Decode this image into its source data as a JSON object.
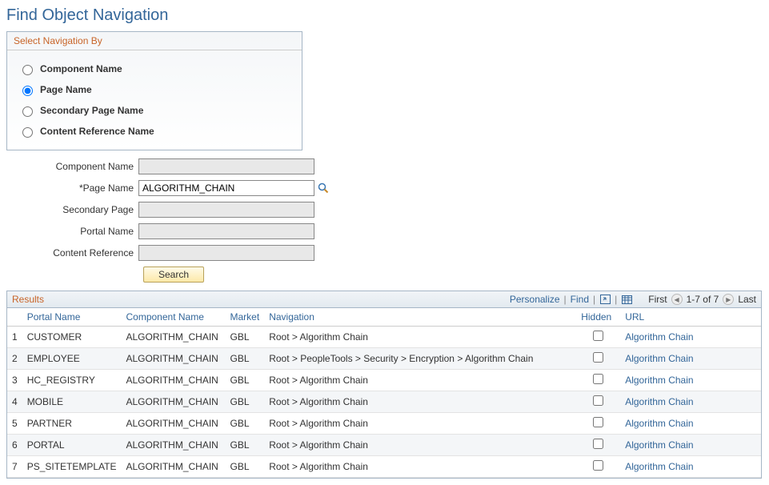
{
  "page": {
    "title": "Find Object Navigation"
  },
  "navBy": {
    "legend": "Select Navigation By",
    "options": [
      {
        "key": "component",
        "label": "Component Name",
        "checked": false
      },
      {
        "key": "page",
        "label": "Page Name",
        "checked": true
      },
      {
        "key": "secondary",
        "label": "Secondary Page Name",
        "checked": false
      },
      {
        "key": "cref",
        "label": "Content Reference Name",
        "checked": false
      }
    ]
  },
  "form": {
    "componentName": {
      "label": "Component Name",
      "value": "",
      "enabled": false
    },
    "pageName": {
      "label": "*Page Name",
      "value": "ALGORITHM_CHAIN",
      "enabled": true,
      "lookup": true
    },
    "secondaryPage": {
      "label": "Secondary Page",
      "value": "",
      "enabled": false
    },
    "portalName": {
      "label": "Portal Name",
      "value": "",
      "enabled": false
    },
    "contentReference": {
      "label": "Content Reference",
      "value": "",
      "enabled": false
    },
    "searchLabel": "Search"
  },
  "results": {
    "title": "Results",
    "toolbar": {
      "personalize": "Personalize",
      "find": "Find",
      "first": "First",
      "range": "1-7 of 7",
      "last": "Last"
    },
    "columns": {
      "idx": "",
      "portal": "Portal Name",
      "component": "Component Name",
      "market": "Market",
      "navigation": "Navigation",
      "hidden": "Hidden",
      "url": "URL"
    },
    "rows": [
      {
        "idx": "1",
        "portal": "CUSTOMER",
        "component": "ALGORITHM_CHAIN",
        "market": "GBL",
        "navigation": "Root > Algorithm Chain",
        "hidden": false,
        "url": "Algorithm Chain"
      },
      {
        "idx": "2",
        "portal": "EMPLOYEE",
        "component": "ALGORITHM_CHAIN",
        "market": "GBL",
        "navigation": "Root > PeopleTools > Security > Encryption > Algorithm Chain",
        "hidden": false,
        "url": "Algorithm Chain"
      },
      {
        "idx": "3",
        "portal": "HC_REGISTRY",
        "component": "ALGORITHM_CHAIN",
        "market": "GBL",
        "navigation": "Root > Algorithm Chain",
        "hidden": false,
        "url": "Algorithm Chain"
      },
      {
        "idx": "4",
        "portal": "MOBILE",
        "component": "ALGORITHM_CHAIN",
        "market": "GBL",
        "navigation": "Root > Algorithm Chain",
        "hidden": false,
        "url": "Algorithm Chain"
      },
      {
        "idx": "5",
        "portal": "PARTNER",
        "component": "ALGORITHM_CHAIN",
        "market": "GBL",
        "navigation": "Root > Algorithm Chain",
        "hidden": false,
        "url": "Algorithm Chain"
      },
      {
        "idx": "6",
        "portal": "PORTAL",
        "component": "ALGORITHM_CHAIN",
        "market": "GBL",
        "navigation": "Root > Algorithm Chain",
        "hidden": false,
        "url": "Algorithm Chain"
      },
      {
        "idx": "7",
        "portal": "PS_SITETEMPLATE",
        "component": "ALGORITHM_CHAIN",
        "market": "GBL",
        "navigation": "Root > Algorithm Chain",
        "hidden": false,
        "url": "Algorithm Chain"
      }
    ]
  }
}
